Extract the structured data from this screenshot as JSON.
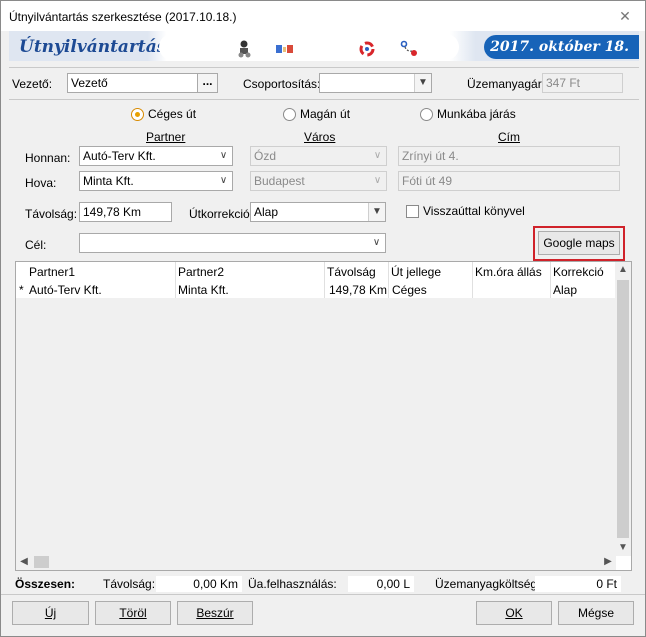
{
  "window": {
    "title": "Útnyilvántartás szerkesztése (2017.10.18.)",
    "close_glyph": "✕"
  },
  "banner": {
    "logo": "Útnyilvántartás",
    "date": "2017. október 18."
  },
  "header": {
    "driver_label": "Vezető:",
    "driver_value": "Vezető",
    "driver_button": "...",
    "grouping_label": "Csoportosítás:",
    "grouping_value": "",
    "fuel_label": "Üzemanyagár:",
    "fuel_value": "347 Ft"
  },
  "trip_type": {
    "options": [
      {
        "label": "Céges út",
        "checked": true
      },
      {
        "label": "Magán út",
        "checked": false
      },
      {
        "label": "Munkába járás",
        "checked": false
      }
    ]
  },
  "columns": {
    "partner": "Partner",
    "city": "Város",
    "address": "Cím"
  },
  "from": {
    "label": "Honnan:",
    "partner": "Autó-Terv Kft.",
    "city": "Ózd",
    "address": "Zrínyi út 4."
  },
  "to": {
    "label": "Hova:",
    "partner": "Minta Kft.",
    "city": "Budapest",
    "address": "Fóti út 49"
  },
  "distance": {
    "label": "Távolság:",
    "value": "149,78 Km"
  },
  "correction": {
    "label": "Útkorrekció:",
    "value": "Alap"
  },
  "return_trip": {
    "label": "Visszaúttal könyvel",
    "checked": false
  },
  "goal": {
    "label": "Cél:",
    "value": ""
  },
  "google_maps_button": "Google maps",
  "table": {
    "headers": [
      "Partner1",
      "Partner2",
      "Távolság",
      "Út jellege",
      "Km.óra állás",
      "Korrekció"
    ],
    "rows": [
      {
        "marker": "*",
        "cells": [
          "Autó-Terv Kft.",
          "Minta Kft.",
          "149,78 Km",
          "Céges",
          "",
          "Alap"
        ]
      }
    ]
  },
  "summary": {
    "total_label": "Összesen:",
    "distance_label": "Távolság:",
    "distance_value": "0,00 Km",
    "fuel_use_label": "Üa.felhasználás:",
    "fuel_use_value": "0,00 L",
    "fuel_cost_label": "Üzemanyagköltség:",
    "fuel_cost_value": "0 Ft"
  },
  "buttons": {
    "new": "Új",
    "delete": "Töröl",
    "insert": "Beszúr",
    "ok": "OK",
    "cancel": "Mégse"
  }
}
